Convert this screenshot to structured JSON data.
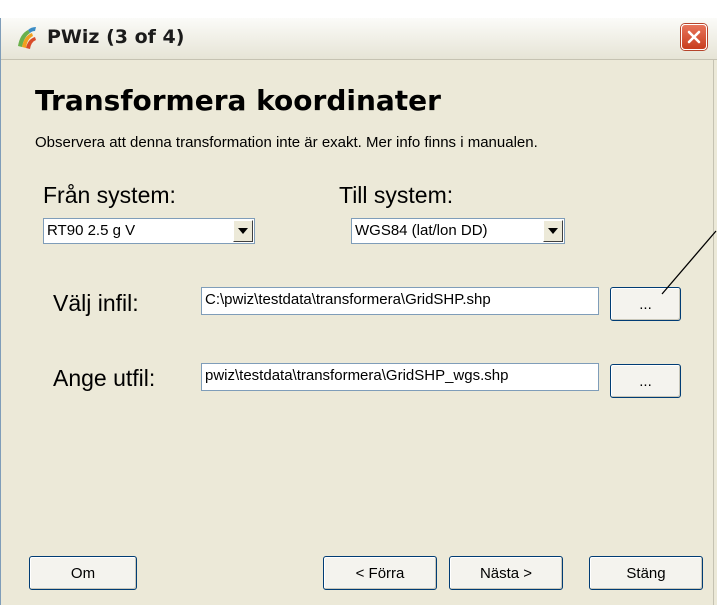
{
  "window": {
    "title": "PWiz (3 of 4)",
    "app_icon": "pwiz-logo-icon",
    "close_icon": "close-icon"
  },
  "page": {
    "heading": "Transformera koordinater",
    "notice": "Observera att denna transformation inte är exakt. Mer info finns i manualen."
  },
  "from_system": {
    "label": "Från system:",
    "selected": "RT90 2.5 g V"
  },
  "to_system": {
    "label": "Till system:",
    "selected": "WGS84 (lat/lon DD)"
  },
  "infile": {
    "label": "Välj infil:",
    "value": "C:\\pwiz\\testdata\\transformera\\GridSHP.shp",
    "browse_label": "..."
  },
  "outfile": {
    "label": "Ange utfil:",
    "value": "pwiz\\testdata\\transformera\\GridSHP_wgs.shp",
    "browse_label": "..."
  },
  "footer": {
    "about_label": "Om",
    "back_label": "< Förra",
    "next_label": "Nästa >",
    "close_label": "Stäng"
  },
  "colors": {
    "window_bg": "#ece9d8",
    "close_button": "#c83d1e",
    "field_border": "#7f9db9"
  }
}
